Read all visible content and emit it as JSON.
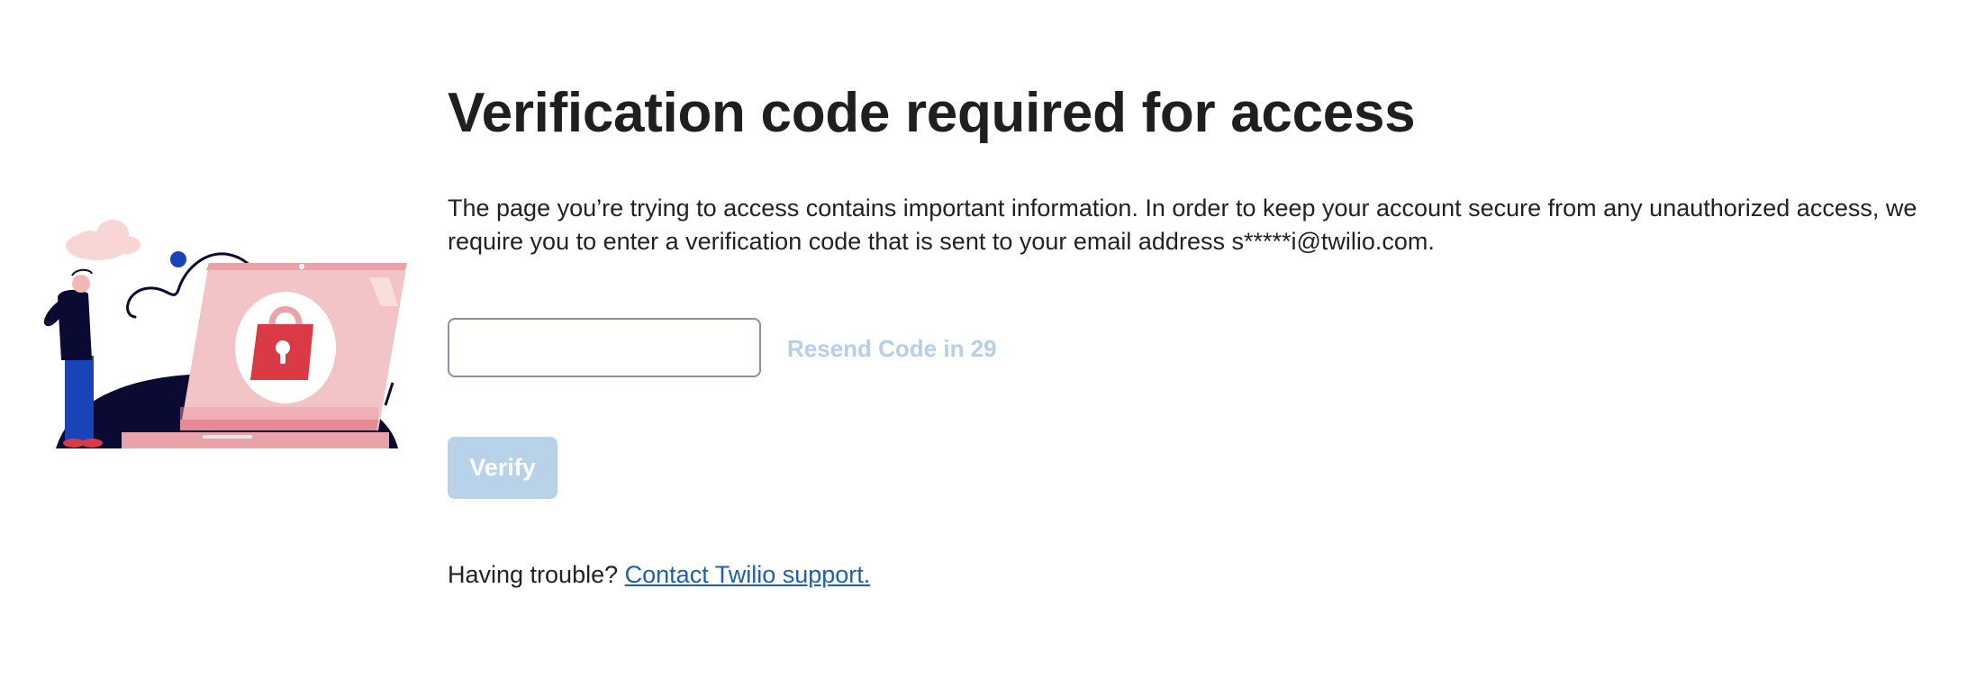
{
  "page": {
    "title": "Verification code required for access",
    "description": "The page you’re trying to access contains important information. In order to keep your account secure from any unauthorized access, we require you to enter a verification code that is sent to your email address s*****i@twilio.com."
  },
  "form": {
    "code_input_value": "",
    "code_input_placeholder": "",
    "resend_label": "Resend Code in 29",
    "verify_label": "Verify"
  },
  "help": {
    "prefix": "Having trouble?",
    "link_label": "Contact Twilio support."
  },
  "illustration": {
    "icon": "laptop-lock-illustration"
  },
  "colors": {
    "heading": "#1f1f1f",
    "link": "#1f5fae",
    "disabled_button": "#b8d2ea",
    "disabled_text": "#b5cfe6",
    "lock_red": "#d93a45",
    "laptop_pink": "#f3c4c6",
    "navy": "#0b0a33",
    "blue": "#1844b8"
  }
}
